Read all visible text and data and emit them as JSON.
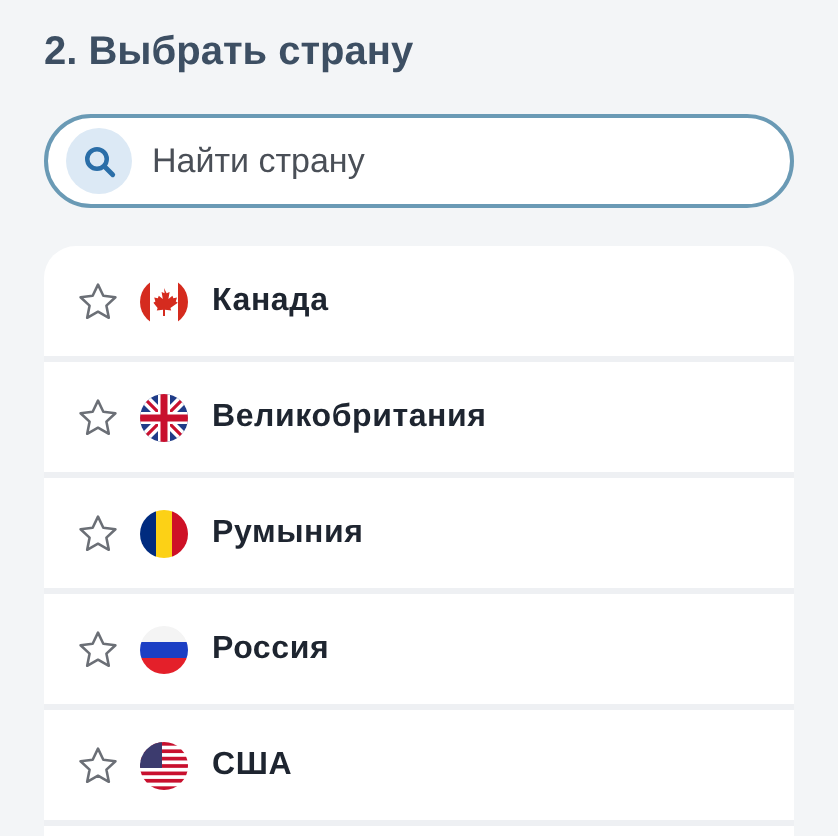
{
  "title": "2. Выбрать страну",
  "search": {
    "placeholder": "Найти страну"
  },
  "countries": [
    {
      "name": "Канада",
      "kind": "ca",
      "favorite": false
    },
    {
      "name": "Великобритания",
      "kind": "gb",
      "favorite": false
    },
    {
      "name": "Румыния",
      "kind": "ro",
      "favorite": false
    },
    {
      "name": "Россия",
      "kind": "ru",
      "favorite": false
    },
    {
      "name": "США",
      "kind": "us",
      "favorite": false
    }
  ]
}
